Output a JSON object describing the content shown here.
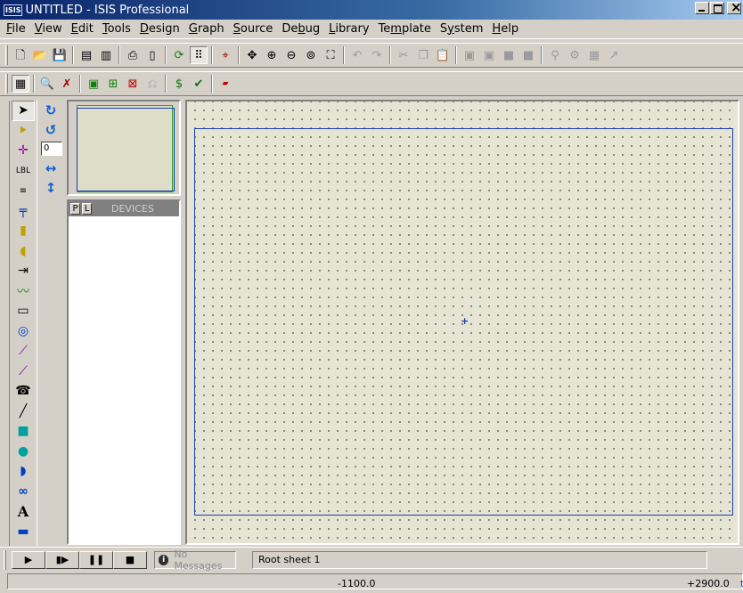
{
  "window": {
    "badge": "ISIS",
    "title": "UNTITLED - ISIS Professional"
  },
  "menu": [
    {
      "u": "F",
      "rest": "ile"
    },
    {
      "u": "V",
      "rest": "iew"
    },
    {
      "u": "E",
      "rest": "dit"
    },
    {
      "u": "T",
      "rest": "ools"
    },
    {
      "u": "D",
      "rest": "esign"
    },
    {
      "u": "G",
      "rest": "raph"
    },
    {
      "u": "S",
      "rest": "ource"
    },
    {
      "pre": "De",
      "u": "b",
      "rest": "ug"
    },
    {
      "u": "L",
      "rest": "ibrary"
    },
    {
      "pre": "Te",
      "u": "m",
      "rest": "plate"
    },
    {
      "pre": "S",
      "u": "y",
      "rest": "stem"
    },
    {
      "u": "H",
      "rest": "elp"
    }
  ],
  "icons": {
    "toolbar1": [
      "new-file-icon",
      "open-file-icon",
      "save-icon",
      "import-section-icon",
      "export-section-icon",
      "print-icon",
      "print-area-icon",
      "refresh-icon",
      "grid-icon",
      "origin-icon",
      "pan-icon",
      "zoom-in-icon",
      "zoom-out-icon",
      "zoom-all-icon",
      "zoom-area-icon",
      "undo-icon",
      "redo-icon",
      "cut-icon",
      "copy-icon",
      "paste-icon",
      "block-copy-icon",
      "block-move-icon",
      "block-rotate-icon",
      "block-delete-icon",
      "pick-device-icon",
      "make-device-icon",
      "decompose-icon",
      "wire-autorouter-icon"
    ],
    "toolbar2": [
      "property-assignment-icon",
      "search-icon",
      "tag-icon",
      "netlist-icon",
      "new-sheet-icon",
      "delete-sheet-icon",
      "goto-sheet-icon",
      "bill-of-materials-icon",
      "electrical-rule-check-icon",
      "netlist-to-ares-icon"
    ],
    "left": [
      "selection-mode-icon",
      "component-mode-icon",
      "junction-dot-icon",
      "wire-label-icon",
      "text-script-icon",
      "buses-icon",
      "subcircuit-icon",
      "terminals-icon",
      "device-pins-icon",
      "graph-icon",
      "tape-recorder-icon",
      "generator-icon",
      "voltage-probe-icon",
      "current-probe-icon",
      "virtual-instruments-icon",
      "line-icon",
      "box-icon",
      "circle-icon",
      "arc-icon",
      "path-icon",
      "text-icon",
      "symbol-icon"
    ],
    "rotation": [
      "rotate-clockwise-icon",
      "rotate-anticlockwise-icon",
      "mirror-horizontal-icon",
      "mirror-vertical-icon"
    ]
  },
  "rotation": {
    "angle": "0"
  },
  "devices": {
    "p_label": "P",
    "l_label": "L",
    "title": "DEVICES"
  },
  "status": {
    "messages": "No Messages",
    "sheet": "Root sheet 1",
    "x": "-1100.0",
    "y": "+2900.0",
    "unit": "th"
  },
  "colors": {
    "canvas": "#e6e5d4",
    "sheet_border": "#1a3fb0",
    "title_gradient_start": "#0a246a"
  }
}
